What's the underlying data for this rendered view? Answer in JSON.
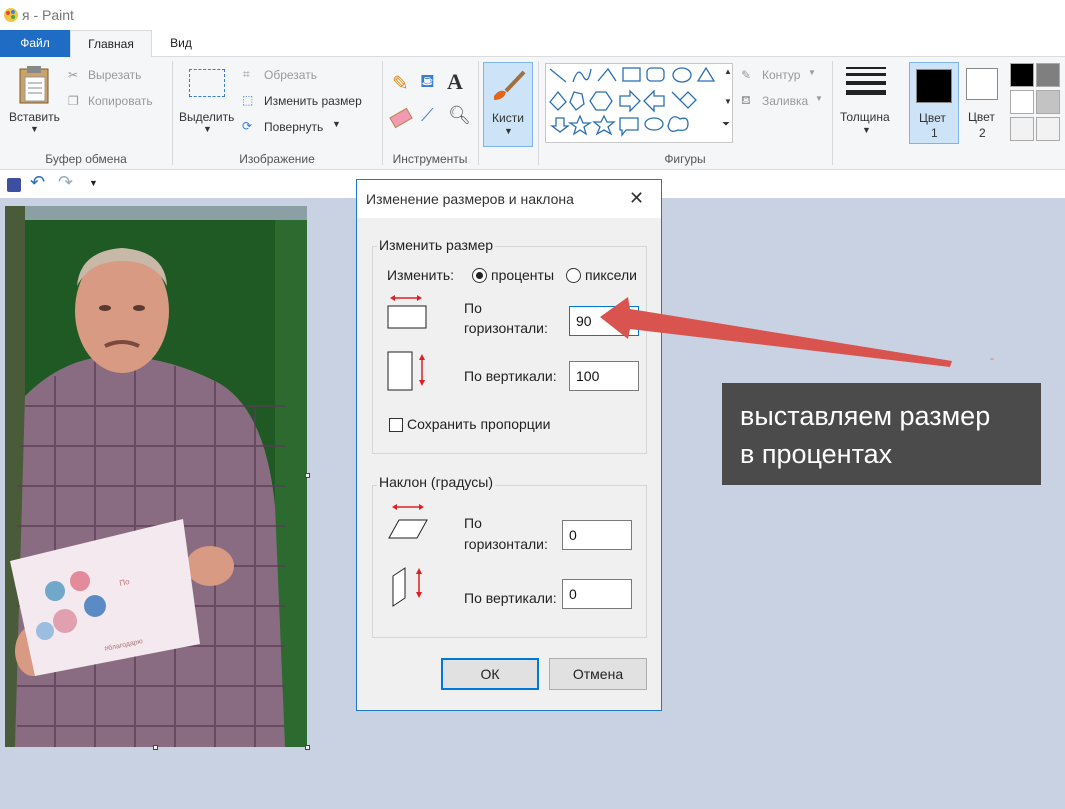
{
  "window": {
    "title": "я - Paint"
  },
  "tabs": {
    "file": "Файл",
    "home": "Главная",
    "view": "Вид"
  },
  "ribbon": {
    "clipboard": {
      "paste": "Вставить",
      "cut": "Вырезать",
      "copy": "Копировать",
      "label": "Буфер обмена"
    },
    "image": {
      "select": "Выделить",
      "crop": "Обрезать",
      "resize": "Изменить размер",
      "rotate": "Повернуть",
      "label": "Изображение"
    },
    "tools": {
      "label": "Инструменты"
    },
    "brushes": {
      "label": "Кисти"
    },
    "shapes": {
      "outline": "Контур",
      "fill": "Заливка",
      "label": "Фигуры"
    },
    "size": {
      "label": "Толщина"
    },
    "colors": {
      "color1": "Цвет",
      "color1_num": "1",
      "color2": "Цвет",
      "color2_num": "2"
    }
  },
  "dialog": {
    "title": "Изменение размеров и наклона",
    "resize_group": "Изменить размер",
    "by_label": "Изменить:",
    "percent": "проценты",
    "pixels": "пиксели",
    "horizontal_1": "По",
    "horizontal_2": "горизонтали:",
    "horizontal_value": "90",
    "vertical": "По вертикали:",
    "vertical_value": "100",
    "keep_ratio": "Сохранить пропорции",
    "skew_group": "Наклон (градусы)",
    "skew_horizontal_1": "По",
    "skew_horizontal_2": "горизонтали:",
    "skew_h_value": "0",
    "skew_vertical": "По вертикали:",
    "skew_v_value": "0",
    "ok": "ОК",
    "cancel": "Отмена"
  },
  "annotation": {
    "callout_line1": "выставляем размер",
    "callout_line2": "в процентах",
    "arrow_color": "#d9534f"
  },
  "palette": [
    "#000000",
    "#7f7f7f",
    "#ffffff",
    "#c3c3c3",
    "#ffffff",
    "#ffffff"
  ]
}
